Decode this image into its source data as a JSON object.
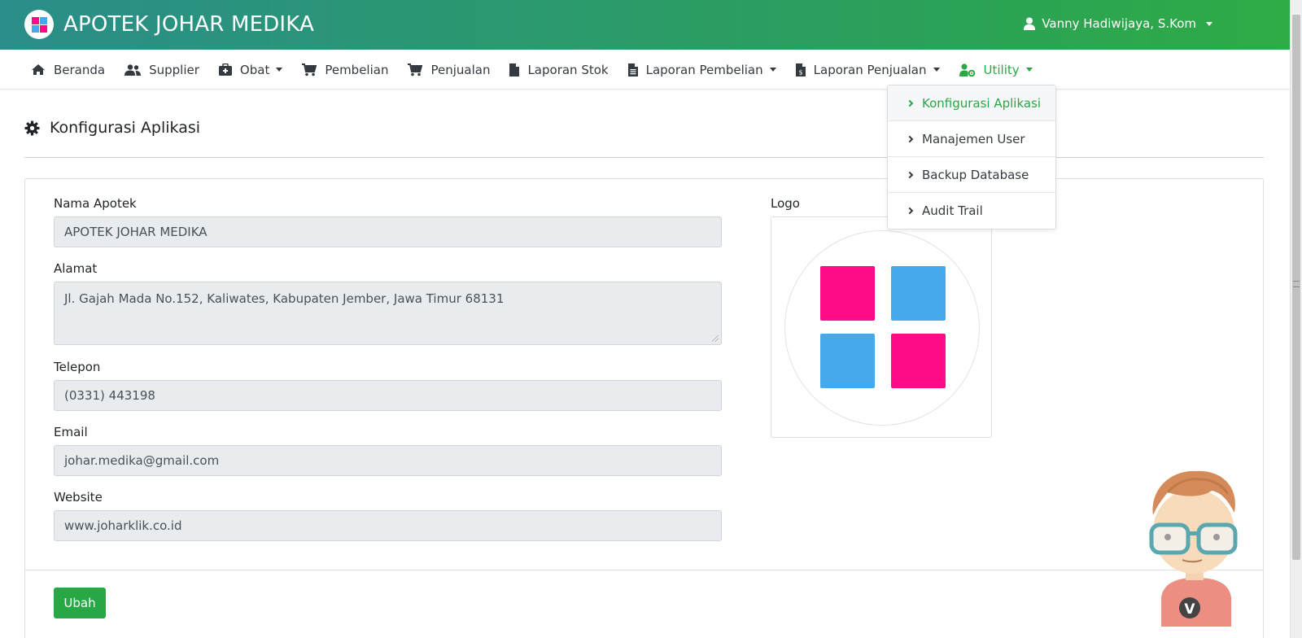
{
  "app": {
    "name": "APOTEK JOHAR MEDIKA",
    "user": "Vanny Hadiwijaya, S.Kom"
  },
  "nav": {
    "items": [
      {
        "label": "Beranda",
        "icon": "home-icon"
      },
      {
        "label": "Supplier",
        "icon": "users-icon"
      },
      {
        "label": "Obat",
        "icon": "medkit-icon",
        "dropdown": true
      },
      {
        "label": "Pembelian",
        "icon": "cart-icon"
      },
      {
        "label": "Penjualan",
        "icon": "cart-icon"
      },
      {
        "label": "Laporan Stok",
        "icon": "file-icon"
      },
      {
        "label": "Laporan Pembelian",
        "icon": "file-text-icon",
        "dropdown": true
      },
      {
        "label": "Laporan Penjualan",
        "icon": "file-invoice-icon",
        "dropdown": true
      },
      {
        "label": "Utility",
        "icon": "user-cog-icon",
        "dropdown": true,
        "active": true
      }
    ]
  },
  "utility_menu": {
    "items": [
      {
        "label": "Konfigurasi Aplikasi",
        "active": true
      },
      {
        "label": "Manajemen User"
      },
      {
        "label": "Backup Database"
      },
      {
        "label": "Audit Trail"
      }
    ]
  },
  "page": {
    "title": "Konfigurasi Aplikasi"
  },
  "form": {
    "nama_label": "Nama Apotek",
    "nama_value": "APOTEK JOHAR MEDIKA",
    "alamat_label": "Alamat",
    "alamat_value": "Jl. Gajah Mada No.152, Kaliwates, Kabupaten Jember, Jawa Timur 68131",
    "telepon_label": "Telepon",
    "telepon_value": "(0331) 443198",
    "email_label": "Email",
    "email_value": "johar.medika@gmail.com",
    "website_label": "Website",
    "website_value": "www.joharklik.co.id",
    "logo_label": "Logo",
    "submit_label": "Ubah"
  },
  "colors": {
    "header_start": "#2a8e8a",
    "header_end": "#2fab45",
    "accent": "#28a745",
    "logo_pink": "#ff0a87",
    "logo_blue": "#45a9ec"
  }
}
